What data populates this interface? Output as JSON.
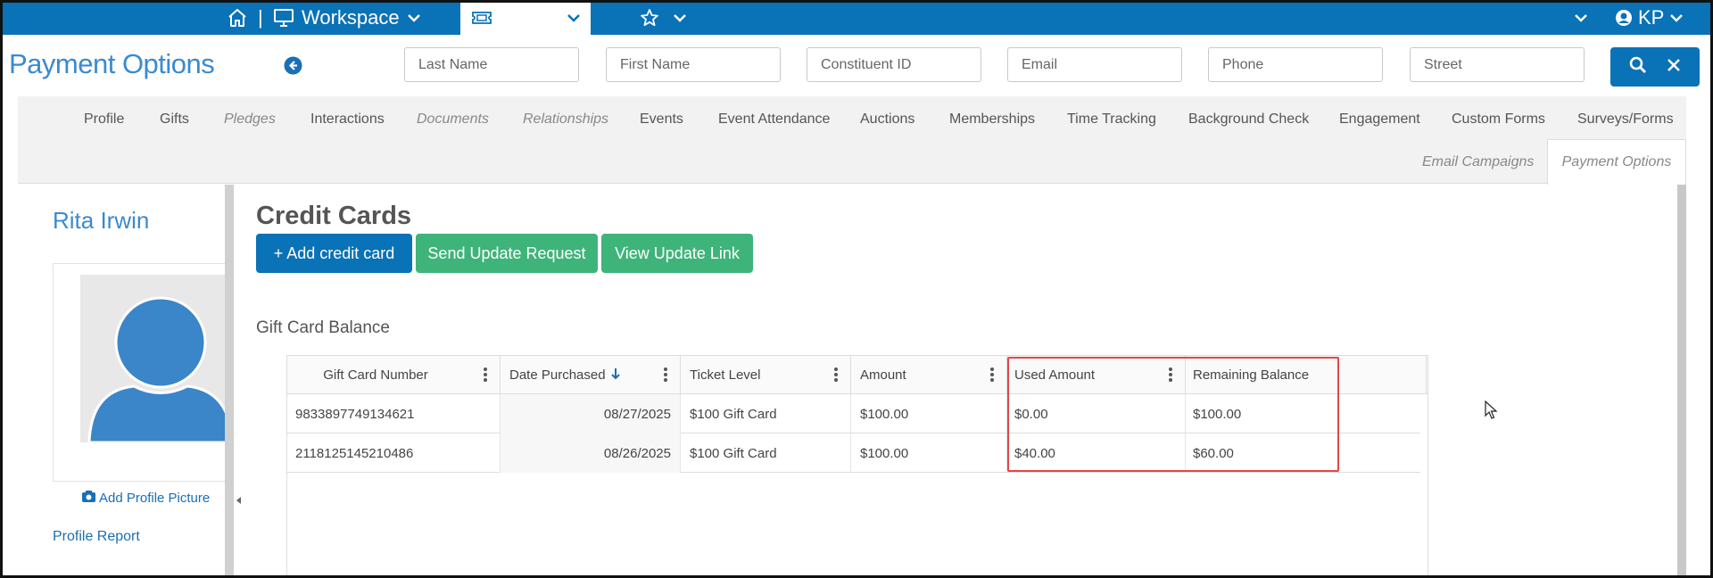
{
  "topbar": {
    "separator": "|",
    "workspace_label": "Workspace",
    "events_label": "Events",
    "user_initials": "KP",
    "icons": [
      "home-icon",
      "monitor-icon",
      "chevron-down-icon",
      "ticket-icon",
      "star-icon",
      "user-circle-icon"
    ]
  },
  "header": {
    "page_title": "Payment Options",
    "search_fields": [
      {
        "placeholder": "Last Name"
      },
      {
        "placeholder": "First Name"
      },
      {
        "placeholder": "Constituent ID"
      },
      {
        "placeholder": "Email"
      },
      {
        "placeholder": "Phone"
      },
      {
        "placeholder": "Street"
      }
    ]
  },
  "tabs": {
    "row1": [
      {
        "label": "Profile",
        "italic": false
      },
      {
        "label": "Gifts",
        "italic": false
      },
      {
        "label": "Pledges",
        "italic": true
      },
      {
        "label": "Interactions",
        "italic": false
      },
      {
        "label": "Documents",
        "italic": true
      },
      {
        "label": "Relationships",
        "italic": true
      },
      {
        "label": "Events",
        "italic": false
      },
      {
        "label": "Event Attendance",
        "italic": false
      },
      {
        "label": "Auctions",
        "italic": false
      },
      {
        "label": "Memberships",
        "italic": false
      },
      {
        "label": "Time Tracking",
        "italic": false
      },
      {
        "label": "Background Check",
        "italic": false
      },
      {
        "label": "Engagement",
        "italic": false
      },
      {
        "label": "Custom Forms",
        "italic": false
      },
      {
        "label": "Surveys/Forms",
        "italic": false
      }
    ],
    "row2": [
      {
        "label": "Email Campaigns",
        "italic": true
      }
    ],
    "active": "Payment Options"
  },
  "profile": {
    "name": "Rita Irwin",
    "add_picture_label": "Add Profile Picture",
    "report_label": "Profile Report"
  },
  "main": {
    "section_title": "Credit Cards",
    "buttons": {
      "add": "+ Add credit card",
      "send": "Send Update Request",
      "view": "View Update Link"
    },
    "gift_card_title": "Gift Card Balance",
    "grid": {
      "columns": [
        "Gift Card Number",
        "Date Purchased",
        "Ticket Level",
        "Amount",
        "Used Amount",
        "Remaining Balance"
      ],
      "sort_column": "Date Purchased",
      "sort_direction": "descending",
      "rows": [
        [
          "9833897749134621",
          "08/27/2025",
          "$100 Gift Card",
          "$100.00",
          "$0.00",
          "$100.00"
        ],
        [
          "2118125145210486",
          "08/26/2025",
          "$100 Gift Card",
          "$100.00",
          "$40.00",
          "$60.00"
        ]
      ]
    }
  },
  "colors": {
    "brand_blue": "#0a72b6",
    "title_blue": "#3a8ad0",
    "green_button": "#3fb47a",
    "highlight_red": "#e04848"
  }
}
